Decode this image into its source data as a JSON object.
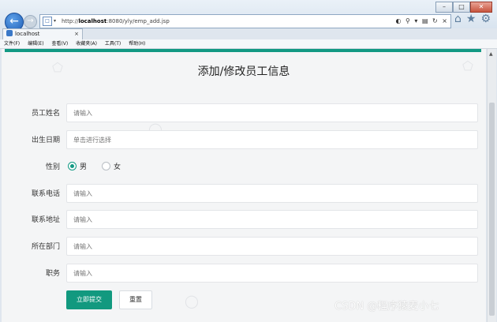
{
  "browser": {
    "url_prefix": "http://",
    "url_host": "localhost",
    "url_rest": ":8080/yly/emp_add.jsp",
    "tab_title": "localhost",
    "tab_close": "×",
    "window_buttons": [
      "–",
      "□",
      "✕"
    ]
  },
  "menu": [
    "文件(F)",
    "编辑(E)",
    "查看(V)",
    "收藏夹(A)",
    "工具(T)",
    "帮助(H)"
  ],
  "form": {
    "title": "添加/修改员工信息",
    "fields": [
      {
        "label": "员工姓名",
        "placeholder": "请输入"
      },
      {
        "label": "出生日期",
        "placeholder": "单击进行选择"
      },
      {
        "label": "联系电话",
        "placeholder": "请输入"
      },
      {
        "label": "联系地址",
        "placeholder": "请输入"
      },
      {
        "label": "所在部门",
        "placeholder": "请输入"
      },
      {
        "label": "职务",
        "placeholder": "请输入"
      }
    ],
    "gender": {
      "label": "性别",
      "options": [
        "男",
        "女"
      ],
      "selected": "男"
    },
    "submit_label": "立即提交",
    "reset_label": "重置"
  },
  "colors": {
    "accent": "#129983",
    "page_bg": "#f4f5f6"
  },
  "watermark": "CSDN @程序猿麦小七",
  "icons": {
    "back": "arrow-left-icon",
    "forward": "arrow-right-icon",
    "home": "home-icon",
    "favorites": "star-icon",
    "tools": "gear-icon"
  }
}
